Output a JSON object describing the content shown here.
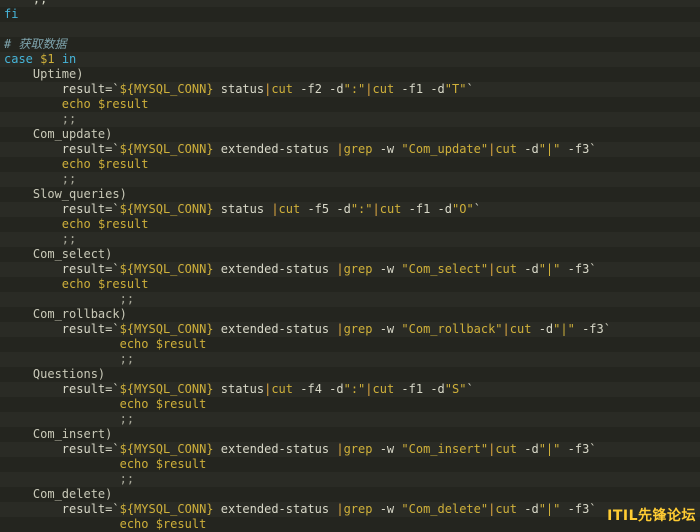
{
  "watermark": "ITIL先锋论坛",
  "colors": {
    "background": "#272822",
    "keyword": "#46b4d8",
    "variable": "#cfb03a",
    "comment": "#7fa5ae",
    "text": "#d8d8c8"
  },
  "lines": [
    [
      [
        "plain",
        "    ;;"
      ]
    ],
    [
      [
        "kw",
        "fi"
      ]
    ],
    [],
    [
      [
        "comment",
        "# 获取数据"
      ]
    ],
    [
      [
        "kw",
        "case"
      ],
      [
        "plain",
        " "
      ],
      [
        "var",
        "$1"
      ],
      [
        "plain",
        " "
      ],
      [
        "kw",
        "in"
      ]
    ],
    [
      [
        "label",
        "    Uptime)"
      ]
    ],
    [
      [
        "plain",
        "        result=`"
      ],
      [
        "var",
        "${MYSQL_CONN}"
      ],
      [
        "plain",
        " status"
      ],
      [
        "pipe",
        "|"
      ],
      [
        "cmd",
        "cut"
      ],
      [
        "plain",
        " -f2 -d"
      ],
      [
        "str",
        "\":\""
      ],
      [
        "pipe",
        "|"
      ],
      [
        "cmd",
        "cut"
      ],
      [
        "plain",
        " -f1 -d"
      ],
      [
        "str",
        "\"T\""
      ],
      [
        "plain",
        "`"
      ]
    ],
    [
      [
        "plain",
        "        "
      ],
      [
        "cmd",
        "echo"
      ],
      [
        "plain",
        " "
      ],
      [
        "var",
        "$result"
      ]
    ],
    [
      [
        "punct",
        "        ;;"
      ]
    ],
    [
      [
        "label",
        "    Com_update)"
      ]
    ],
    [
      [
        "plain",
        "        result=`"
      ],
      [
        "var",
        "${MYSQL_CONN}"
      ],
      [
        "plain",
        " extended-status "
      ],
      [
        "pipe",
        "|"
      ],
      [
        "cmd",
        "grep"
      ],
      [
        "plain",
        " -w "
      ],
      [
        "str",
        "\"Com_update\""
      ],
      [
        "pipe",
        "|"
      ],
      [
        "cmd",
        "cut"
      ],
      [
        "plain",
        " -d"
      ],
      [
        "str",
        "\"|\""
      ],
      [
        "plain",
        " -f3`"
      ]
    ],
    [
      [
        "plain",
        "        "
      ],
      [
        "cmd",
        "echo"
      ],
      [
        "plain",
        " "
      ],
      [
        "var",
        "$result"
      ]
    ],
    [
      [
        "punct",
        "        ;;"
      ]
    ],
    [
      [
        "label",
        "    Slow_queries)"
      ]
    ],
    [
      [
        "plain",
        "        result=`"
      ],
      [
        "var",
        "${MYSQL_CONN}"
      ],
      [
        "plain",
        " status "
      ],
      [
        "pipe",
        "|"
      ],
      [
        "cmd",
        "cut"
      ],
      [
        "plain",
        " -f5 -d"
      ],
      [
        "str",
        "\":\""
      ],
      [
        "pipe",
        "|"
      ],
      [
        "cmd",
        "cut"
      ],
      [
        "plain",
        " -f1 -d"
      ],
      [
        "str",
        "\"O\""
      ],
      [
        "plain",
        "`"
      ]
    ],
    [
      [
        "plain",
        "        "
      ],
      [
        "cmd",
        "echo"
      ],
      [
        "plain",
        " "
      ],
      [
        "var",
        "$result"
      ]
    ],
    [
      [
        "punct",
        "        ;;"
      ]
    ],
    [
      [
        "label",
        "    Com_select)"
      ]
    ],
    [
      [
        "plain",
        "        result=`"
      ],
      [
        "var",
        "${MYSQL_CONN}"
      ],
      [
        "plain",
        " extended-status "
      ],
      [
        "pipe",
        "|"
      ],
      [
        "cmd",
        "grep"
      ],
      [
        "plain",
        " -w "
      ],
      [
        "str",
        "\"Com_select\""
      ],
      [
        "pipe",
        "|"
      ],
      [
        "cmd",
        "cut"
      ],
      [
        "plain",
        " -d"
      ],
      [
        "str",
        "\"|\""
      ],
      [
        "plain",
        " -f3`"
      ]
    ],
    [
      [
        "plain",
        "        "
      ],
      [
        "cmd",
        "echo"
      ],
      [
        "plain",
        " "
      ],
      [
        "var",
        "$result"
      ]
    ],
    [
      [
        "punct",
        "                ;;"
      ]
    ],
    [
      [
        "label",
        "    Com_rollback)"
      ]
    ],
    [
      [
        "plain",
        "        result=`"
      ],
      [
        "var",
        "${MYSQL_CONN}"
      ],
      [
        "plain",
        " extended-status "
      ],
      [
        "pipe",
        "|"
      ],
      [
        "cmd",
        "grep"
      ],
      [
        "plain",
        " -w "
      ],
      [
        "str",
        "\"Com_rollback\""
      ],
      [
        "pipe",
        "|"
      ],
      [
        "cmd",
        "cut"
      ],
      [
        "plain",
        " -d"
      ],
      [
        "str",
        "\"|\""
      ],
      [
        "plain",
        " -f3`"
      ]
    ],
    [
      [
        "plain",
        "                "
      ],
      [
        "cmd",
        "echo"
      ],
      [
        "plain",
        " "
      ],
      [
        "var",
        "$result"
      ]
    ],
    [
      [
        "punct",
        "                ;;"
      ]
    ],
    [
      [
        "label",
        "    Questions)"
      ]
    ],
    [
      [
        "plain",
        "        result=`"
      ],
      [
        "var",
        "${MYSQL_CONN}"
      ],
      [
        "plain",
        " status"
      ],
      [
        "pipe",
        "|"
      ],
      [
        "cmd",
        "cut"
      ],
      [
        "plain",
        " -f4 -d"
      ],
      [
        "str",
        "\":\""
      ],
      [
        "pipe",
        "|"
      ],
      [
        "cmd",
        "cut"
      ],
      [
        "plain",
        " -f1 -d"
      ],
      [
        "str",
        "\"S\""
      ],
      [
        "plain",
        "`"
      ]
    ],
    [
      [
        "plain",
        "                "
      ],
      [
        "cmd",
        "echo"
      ],
      [
        "plain",
        " "
      ],
      [
        "var",
        "$result"
      ]
    ],
    [
      [
        "punct",
        "                ;;"
      ]
    ],
    [
      [
        "label",
        "    Com_insert)"
      ]
    ],
    [
      [
        "plain",
        "        result=`"
      ],
      [
        "var",
        "${MYSQL_CONN}"
      ],
      [
        "plain",
        " extended-status "
      ],
      [
        "pipe",
        "|"
      ],
      [
        "cmd",
        "grep"
      ],
      [
        "plain",
        " -w "
      ],
      [
        "str",
        "\"Com_insert\""
      ],
      [
        "pipe",
        "|"
      ],
      [
        "cmd",
        "cut"
      ],
      [
        "plain",
        " -d"
      ],
      [
        "str",
        "\"|\""
      ],
      [
        "plain",
        " -f3`"
      ]
    ],
    [
      [
        "plain",
        "                "
      ],
      [
        "cmd",
        "echo"
      ],
      [
        "plain",
        " "
      ],
      [
        "var",
        "$result"
      ]
    ],
    [
      [
        "punct",
        "                ;;"
      ]
    ],
    [
      [
        "label",
        "    Com_delete)"
      ]
    ],
    [
      [
        "plain",
        "        result=`"
      ],
      [
        "var",
        "${MYSQL_CONN}"
      ],
      [
        "plain",
        " extended-status "
      ],
      [
        "pipe",
        "|"
      ],
      [
        "cmd",
        "grep"
      ],
      [
        "plain",
        " -w "
      ],
      [
        "str",
        "\"Com_delete\""
      ],
      [
        "pipe",
        "|"
      ],
      [
        "cmd",
        "cut"
      ],
      [
        "plain",
        " -d"
      ],
      [
        "str",
        "\"|\""
      ],
      [
        "plain",
        " -f3`"
      ]
    ],
    [
      [
        "plain",
        "                "
      ],
      [
        "cmd",
        "echo"
      ],
      [
        "plain",
        " "
      ],
      [
        "var",
        "$result"
      ]
    ]
  ]
}
